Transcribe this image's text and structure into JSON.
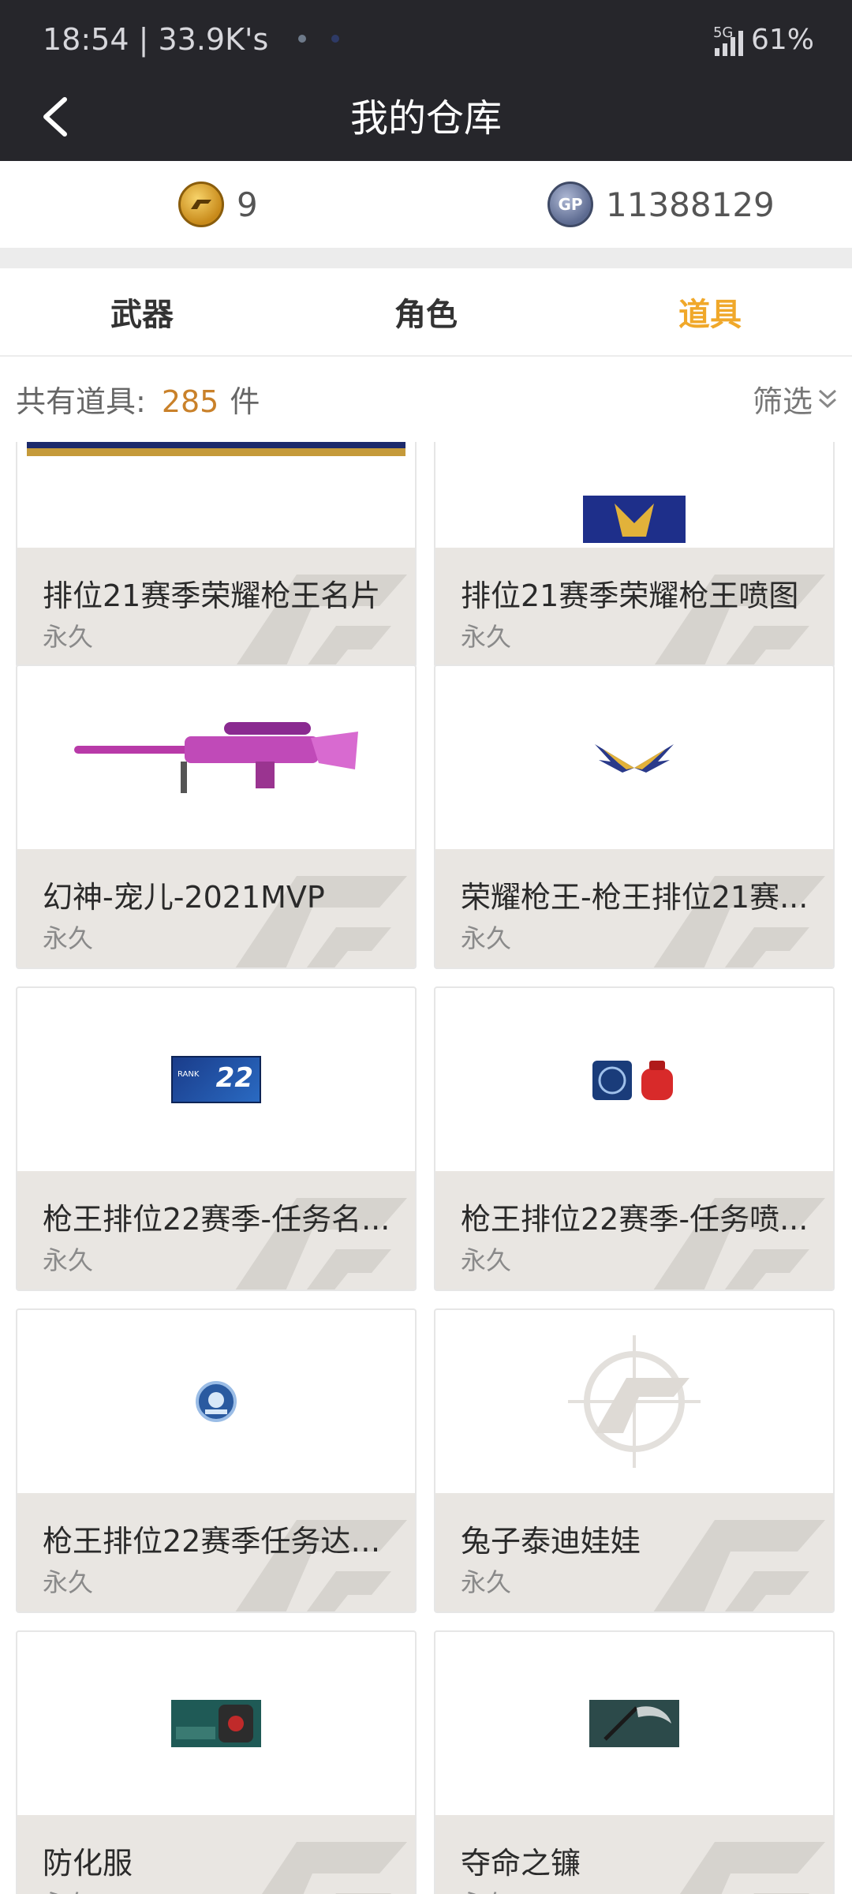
{
  "status_bar": {
    "time_speed": "18:54 | 33.9K's",
    "network": "5G",
    "battery": "61%"
  },
  "header": {
    "title": "我的仓库"
  },
  "currency": {
    "cf_amount": "9",
    "gp_amount": "11388129",
    "cf_icon": "cf-coin-icon",
    "gp_icon": "gp-coin-icon",
    "gp_text": "GP"
  },
  "tabs": [
    {
      "label": "武器"
    },
    {
      "label": "角色"
    },
    {
      "label": "道具",
      "active": true
    }
  ],
  "summary": {
    "prefix": "共有道具:",
    "count": "285",
    "unit": "件",
    "filter_label": "筛选"
  },
  "items": [
    {
      "name": "排位21赛季荣耀枪王名片",
      "duration": "永久",
      "icon": "name-card-image"
    },
    {
      "name": "排位21赛季荣耀枪王喷图",
      "duration": "永久",
      "icon": "spray-image"
    },
    {
      "name": "幻神-宠儿-2021MVP",
      "duration": "永久",
      "icon": "sniper-rifle-image"
    },
    {
      "name": "荣耀枪王-枪王排位21赛...",
      "duration": "永久",
      "icon": "wings-emblem-image"
    },
    {
      "name": "枪王排位22赛季-任务名...",
      "duration": "永久",
      "icon": "rank-22-card-image",
      "badge_text": "RANK",
      "badge_num": "22"
    },
    {
      "name": "枪王排位22赛季-任务喷...",
      "duration": "永久",
      "icon": "rank-22-spray-image"
    },
    {
      "name": "枪王排位22赛季任务达人...",
      "duration": "永久",
      "icon": "round-badge-image"
    },
    {
      "name": "兔子泰迪娃娃",
      "duration": "永久",
      "icon": "cf-placeholder-image"
    },
    {
      "name": "防化服",
      "duration": "永久",
      "icon": "hazmat-suit-image"
    },
    {
      "name": "夺命之镰",
      "duration": "永久",
      "icon": "scythe-image"
    }
  ],
  "colors": {
    "header_bg": "#26262b",
    "accent": "#f0a82a",
    "count_color": "#c9812a",
    "card_info_bg": "#e9e6e2"
  }
}
